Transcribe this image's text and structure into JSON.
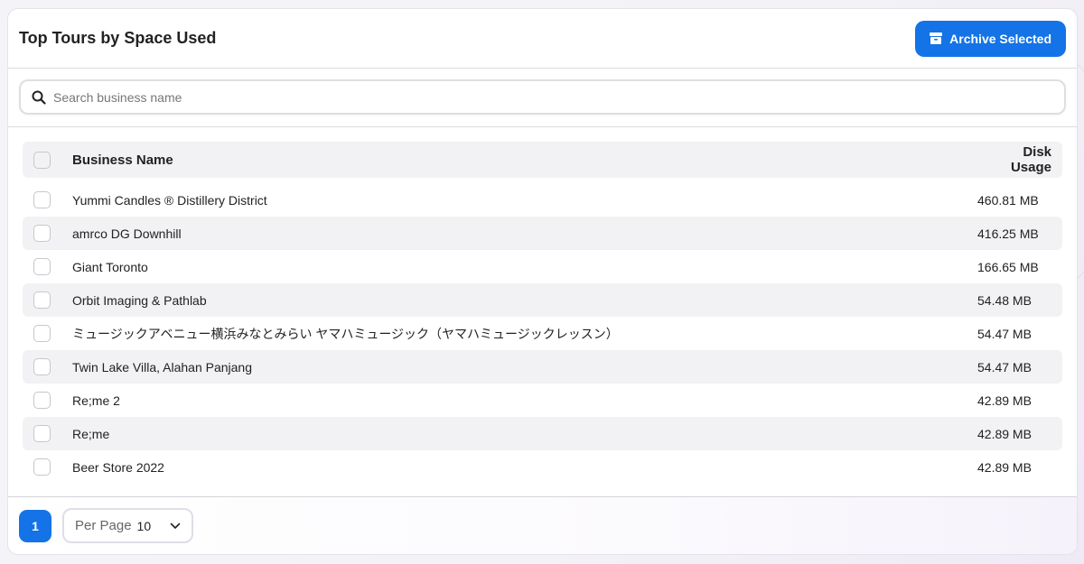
{
  "header": {
    "title": "Top Tours by Space Used",
    "archive_label": "Archive Selected"
  },
  "search": {
    "placeholder": "Search business name",
    "value": ""
  },
  "table": {
    "columns": {
      "name": "Business Name",
      "disk": "Disk Usage"
    },
    "rows": [
      {
        "name": "Yummi Candles ® Distillery District",
        "disk": "460.81 MB"
      },
      {
        "name": "amrco DG Downhill",
        "disk": "416.25 MB"
      },
      {
        "name": "Giant Toronto",
        "disk": "166.65 MB"
      },
      {
        "name": "Orbit Imaging & Pathlab",
        "disk": "54.48 MB"
      },
      {
        "name": "ミュージックアベニュー横浜みなとみらい ヤマハミュージック（ヤマハミュージックレッスン）",
        "disk": "54.47 MB"
      },
      {
        "name": "Twin Lake Villa, Alahan Panjang",
        "disk": "54.47 MB"
      },
      {
        "name": "Re;me 2",
        "disk": "42.89 MB"
      },
      {
        "name": "Re;me",
        "disk": "42.89 MB"
      },
      {
        "name": "Beer Store 2022",
        "disk": "42.89 MB"
      }
    ]
  },
  "pagination": {
    "current_page": "1",
    "per_page_label": "Per Page",
    "per_page_value": "10"
  },
  "colors": {
    "accent": "#1473e6",
    "row_alt": "#f2f2f4"
  },
  "icons": {
    "archive": "archive-icon",
    "search": "search-icon",
    "dropdown": "chevron-down-icon"
  }
}
